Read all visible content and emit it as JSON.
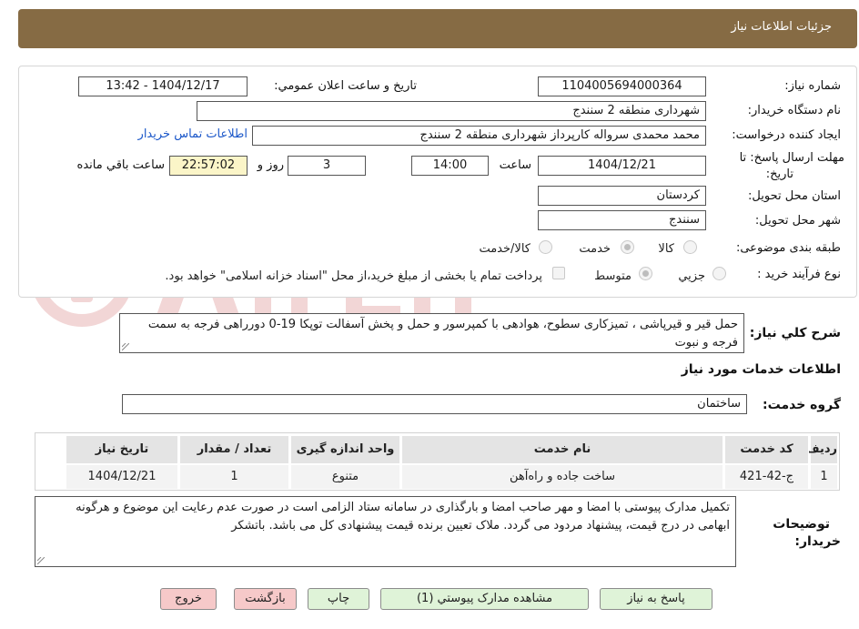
{
  "header": {
    "title": "جزئیات اطلاعات نیاز"
  },
  "form": {
    "need_number_label": "شماره نیاز:",
    "need_number": "1104005694000364",
    "announce_label": "تاریخ و ساعت اعلان عمومي:",
    "announce_value": "1404/12/17 - 13:42",
    "buyer_org_label": "نام دستگاه خریدار:",
    "buyer_org": "شهرداری منطقه 2 سنندج",
    "creator_label": "ایجاد کننده درخواست:",
    "creator": "محمد محمدی سرواله کارپرداز شهرداری منطقه 2 سنندج",
    "contact_link": "اطلاعات تماس خریدار",
    "deadline_label_1": "مهلت ارسال پاسخ: تا",
    "deadline_label_2": "تاریخ:",
    "deadline_date": "1404/12/21",
    "time_label": "ساعت",
    "deadline_time": "14:00",
    "days_value": "3",
    "days_label": "روز و",
    "remaining_time": "22:57:02",
    "remaining_label": "ساعت باقي مانده",
    "province_label": "استان محل تحویل:",
    "province": "کردستان",
    "city_label": "شهر محل تحویل:",
    "city": "سنندج",
    "category_label": "طبقه بندی موضوعی:",
    "category_options": [
      "کالا",
      "خدمت",
      "کالا/خدمت"
    ],
    "category_selected": "خدمت",
    "process_label": "نوع فرآیند خرید :",
    "process_options": [
      "جزیي",
      "متوسط"
    ],
    "process_selected": "متوسط",
    "payment_note": "پرداخت تمام یا بخشی از مبلغ خرید،از محل \"اسناد خزانه اسلامی\" خواهد بود."
  },
  "description": {
    "label": "شرح کلي نیاز:",
    "text": "حمل قیر و قیرپاشی ، تمیزکاری سطوح، هوادهی با کمپرسور و حمل و پخش آسفالت توپکا 19-0 دورراهی فرجه به سمت فرجه و نبوت"
  },
  "services": {
    "section_title": "اطلاعات خدمات مورد نیاز",
    "group_label": "گروه خدمت:",
    "group_value": "ساختمان",
    "columns": [
      "ردیف",
      "کد خدمت",
      "نام خدمت",
      "واحد اندازه گیری",
      "تعداد / مقدار",
      "تاریخ نیاز"
    ],
    "rows": [
      [
        "1",
        "ج-42-421",
        "ساخت جاده و راه‌آهن",
        "متنوع",
        "1",
        "1404/12/21"
      ]
    ]
  },
  "buyer_notes": {
    "label_1": "توضیحات",
    "label_2": "خریدار:",
    "text": "تکمیل مدارک پیوستی با امضا و مهر صاحب امضا و بارگذاری در سامانه ستاد الزامی است در صورت عدم رعایت این موضوع و هرگونه ابهامی در درج قیمت، پیشنهاد مردود می گردد. ملاک تعیین برنده قیمت پیشنهادی کل می باشد. باتشکر"
  },
  "buttons": {
    "reply": "پاسخ به نیاز",
    "attachments": "مشاهده مدارک پیوستي (1)",
    "print": "چاپ",
    "back": "بازگشت",
    "exit": "خروج"
  },
  "colors": {
    "header": "#866b44",
    "link": "#1b57c9",
    "green_button": "#dff3d8",
    "red_button": "#f6c9c9",
    "highlight": "#fbf5c8"
  }
}
